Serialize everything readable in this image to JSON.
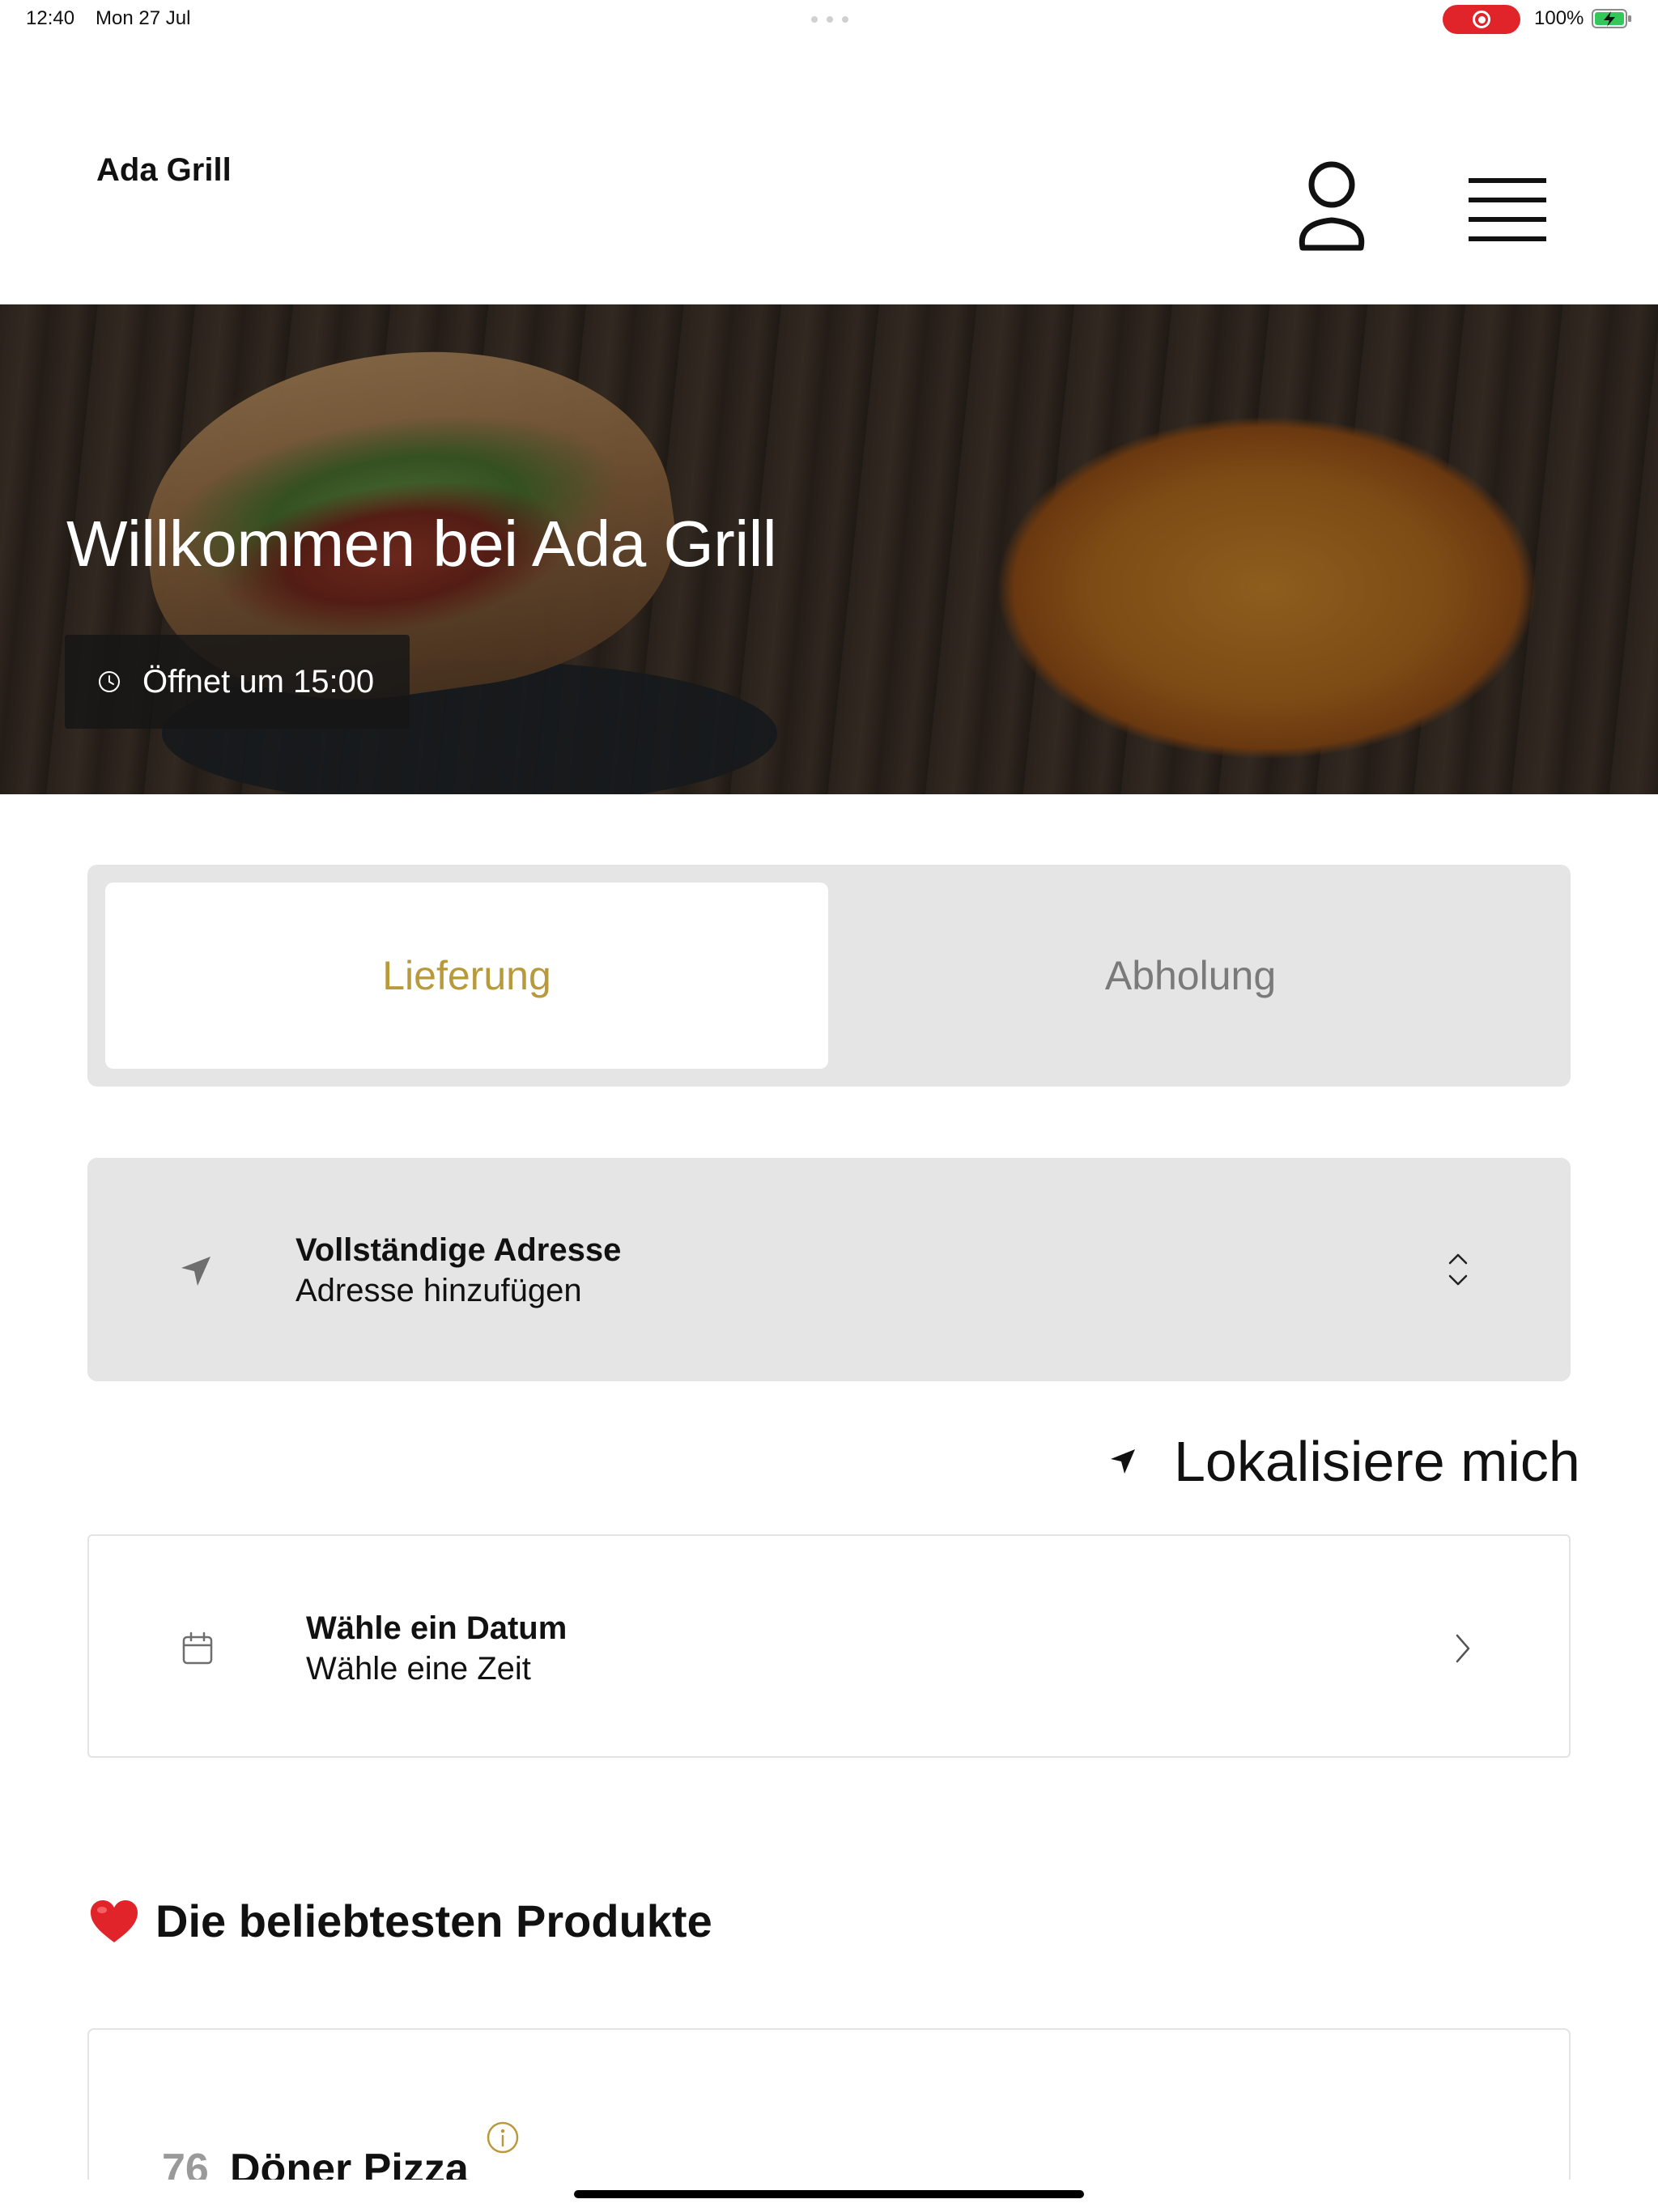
{
  "status_bar": {
    "time": "12:40",
    "date": "Mon 27 Jul",
    "battery_percent": "100%",
    "recording_color": "#e0242a",
    "battery_color": "#34c759"
  },
  "header": {
    "brand": "Ada Grill",
    "user_icon": "user-icon",
    "menu_icon": "hamburger-menu-icon"
  },
  "hero": {
    "title": "Willkommen bei Ada Grill",
    "hours_badge": "Öffnet um 15:00",
    "hours_icon": "clock-icon"
  },
  "order_mode": {
    "active": "Lieferung",
    "inactive": "Abholung",
    "active_color": "#b89a3c"
  },
  "address": {
    "title": "Vollständige Adresse",
    "subtitle": "Adresse hinzufügen",
    "icon": "location-arrow-icon",
    "chevron": "chevron-up-down-icon"
  },
  "locate": {
    "label": "Lokalisiere mich",
    "icon": "location-arrow-icon"
  },
  "schedule": {
    "title": "Wähle ein Datum",
    "subtitle": "Wähle eine Zeit",
    "icon": "calendar-icon",
    "chevron": "chevron-right-icon"
  },
  "popular": {
    "title": "Die beliebtesten Produkte",
    "icon": "heart-icon",
    "items": [
      {
        "number": "76",
        "name": "Döner Pizza"
      }
    ]
  }
}
